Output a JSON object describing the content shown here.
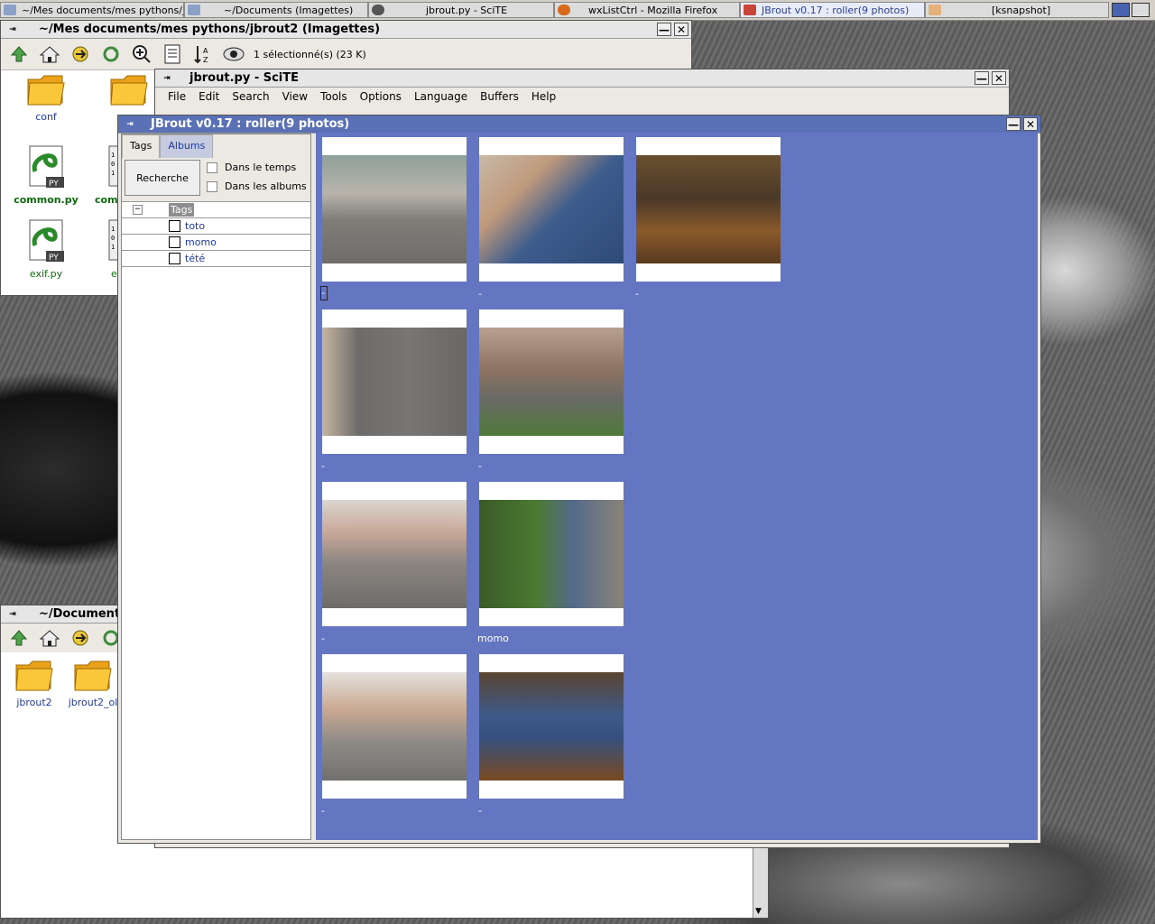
{
  "taskbar": {
    "tasks": [
      {
        "label": "~/Mes documents/mes pythons/j",
        "active": false
      },
      {
        "label": "~/Documents (Imagettes)",
        "active": false
      },
      {
        "label": "jbrout.py - SciTE",
        "active": false
      },
      {
        "label": "wxListCtrl - Mozilla Firefox",
        "active": false
      },
      {
        "label": "JBrout v0.17 : roller(9 photos)",
        "active": true
      },
      {
        "label": "[ksnapshot]",
        "active": false
      }
    ]
  },
  "filemanager_top": {
    "title": "~/Mes documents/mes pythons/jbrout2 (Imagettes)",
    "status": "1 sélectionné(s) (23 K)",
    "files": [
      {
        "label": "conf",
        "kind": "folder"
      },
      {
        "label": "",
        "kind": "folder"
      },
      {
        "label": "common.py",
        "kind": "py"
      },
      {
        "label": "com",
        "kind": "binary"
      },
      {
        "label": "exif.py",
        "kind": "py"
      },
      {
        "label": "ex",
        "kind": "binary"
      }
    ]
  },
  "scite": {
    "title": "jbrout.py - SciTE",
    "menu": [
      "File",
      "Edit",
      "Search",
      "View",
      "Tools",
      "Options",
      "Language",
      "Buffers",
      "Help"
    ]
  },
  "filemanager_bottom": {
    "title": "~/Document",
    "files": [
      {
        "label": "jbrout2"
      },
      {
        "label": "jbrout2_ol"
      }
    ]
  },
  "jbrout": {
    "title": "JBrout v0.17 : roller(9 photos)",
    "tabs": [
      "Tags",
      "Albums"
    ],
    "search_button": "Recherche",
    "options": [
      "Dans le temps",
      "Dans les albums"
    ],
    "tree_root": "Tags",
    "tags": [
      "toto",
      "momo",
      "tété"
    ],
    "photos": [
      {
        "caption": "-"
      },
      {
        "caption": "-"
      },
      {
        "caption": "-"
      },
      {
        "caption": "-"
      },
      {
        "caption": "-"
      },
      {
        "caption": "-"
      },
      {
        "caption": "momo"
      },
      {
        "caption": "-"
      },
      {
        "caption": "-"
      }
    ]
  },
  "colors": {
    "accent": "#5a72b5",
    "grid_background": "#6476c2",
    "link_text": "#1d3aa0"
  }
}
